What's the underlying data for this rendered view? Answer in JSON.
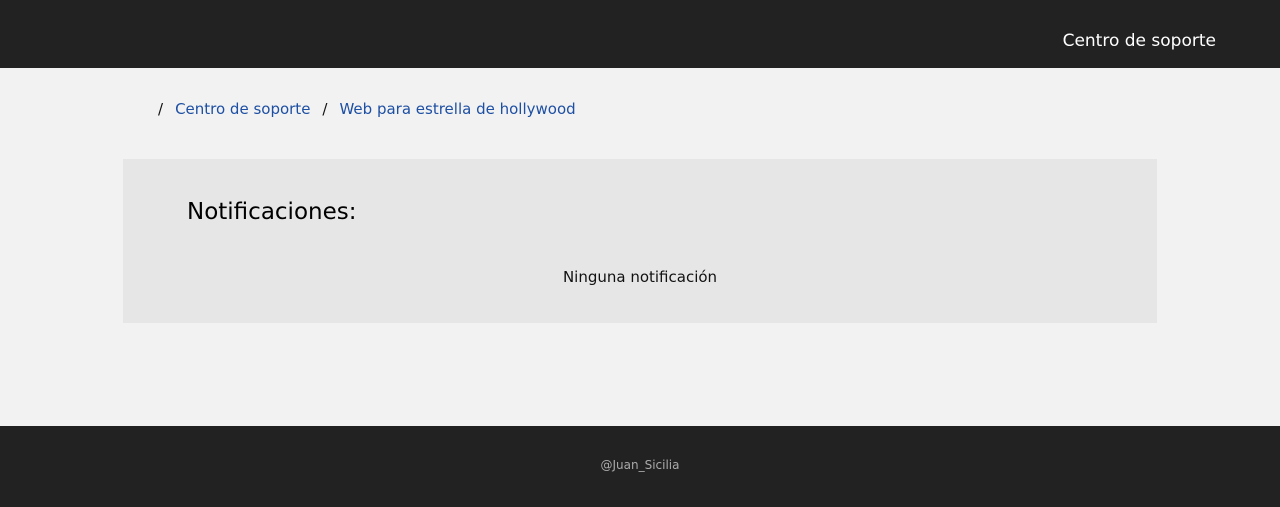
{
  "header": {
    "nav_link": "Centro de soporte"
  },
  "breadcrumb": {
    "separator": "/",
    "items": [
      {
        "label": "Centro de soporte"
      },
      {
        "label": "Web para estrella de hollywood"
      }
    ]
  },
  "notifications": {
    "title": "Notificaciones:",
    "empty_message": "Ninguna notificación"
  },
  "footer": {
    "credit": "@Juan_Sicilia"
  },
  "colors": {
    "bar_background": "#222222",
    "page_background": "#f2f2f2",
    "card_background": "#e6e6e6",
    "link": "#1d4fa3"
  }
}
